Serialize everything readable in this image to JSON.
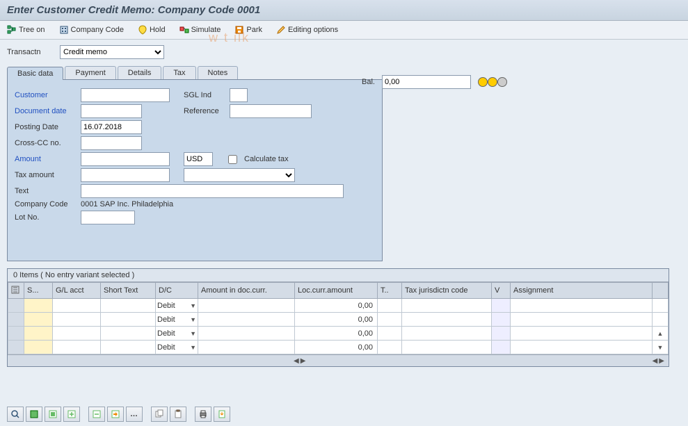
{
  "title": "Enter Customer Credit Memo: Company Code 0001",
  "watermark": "w   t   ilk",
  "toolbar": {
    "tree_on": "Tree on",
    "company_code": "Company Code",
    "hold": "Hold",
    "simulate": "Simulate",
    "park": "Park",
    "editing_options": "Editing options"
  },
  "transactn": {
    "label": "Transactn",
    "value": "Credit memo"
  },
  "balance": {
    "label": "Bal.",
    "value": "0,00"
  },
  "tabs": [
    "Basic data",
    "Payment",
    "Details",
    "Tax",
    "Notes"
  ],
  "active_tab": 0,
  "form": {
    "customer": {
      "label": "Customer",
      "value": ""
    },
    "sgl_ind": {
      "label": "SGL Ind",
      "value": ""
    },
    "document_date": {
      "label": "Document date",
      "value": ""
    },
    "reference": {
      "label": "Reference",
      "value": ""
    },
    "posting_date": {
      "label": "Posting Date",
      "value": "16.07.2018"
    },
    "cross_cc": {
      "label": "Cross-CC no.",
      "value": ""
    },
    "amount": {
      "label": "Amount",
      "value": ""
    },
    "currency": {
      "value": "USD"
    },
    "calculate_tax": {
      "label": "Calculate tax",
      "checked": false
    },
    "tax_amount": {
      "label": "Tax amount",
      "value": ""
    },
    "tax_code": {
      "value": ""
    },
    "text": {
      "label": "Text",
      "value": ""
    },
    "company_code": {
      "label": "Company Code",
      "value": "0001 SAP Inc. Philadelphia"
    },
    "lot_no": {
      "label": "Lot No.",
      "value": ""
    }
  },
  "grid": {
    "title": "0 Items ( No entry variant selected )",
    "columns": [
      "S...",
      "G/L acct",
      "Short Text",
      "D/C",
      "Amount in doc.curr.",
      "Loc.curr.amount",
      "T..",
      "Tax jurisdictn code",
      "V",
      "Assignment"
    ],
    "rows": [
      {
        "s": "",
        "gl": "",
        "short": "",
        "dc": "Debit",
        "amt_doc": "",
        "amt_loc": "0,00",
        "t": "",
        "tj": "",
        "v": "",
        "asg": ""
      },
      {
        "s": "",
        "gl": "",
        "short": "",
        "dc": "Debit",
        "amt_doc": "",
        "amt_loc": "0,00",
        "t": "",
        "tj": "",
        "v": "",
        "asg": ""
      },
      {
        "s": "",
        "gl": "",
        "short": "",
        "dc": "Debit",
        "amt_doc": "",
        "amt_loc": "0,00",
        "t": "",
        "tj": "",
        "v": "",
        "asg": ""
      },
      {
        "s": "",
        "gl": "",
        "short": "",
        "dc": "Debit",
        "amt_doc": "",
        "amt_loc": "0,00",
        "t": "",
        "tj": "",
        "v": "",
        "asg": ""
      }
    ]
  }
}
